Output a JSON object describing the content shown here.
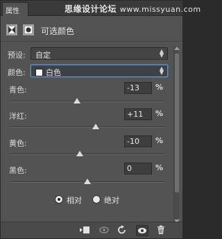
{
  "tab": {
    "label": "属性"
  },
  "watermark": {
    "brand": "思缘设计论坛",
    "url": "www.missyuan.com"
  },
  "header": {
    "title": "可选颜色",
    "icons": [
      "adjustment-layer-icon",
      "mask-icon"
    ]
  },
  "preset": {
    "label": "预设:",
    "value": "自定"
  },
  "colors": {
    "label": "颜色:",
    "value": "白色",
    "swatch": "#ffffff"
  },
  "sliders": [
    {
      "label": "青色:",
      "value": "-13",
      "unit": "%",
      "level": -13
    },
    {
      "label": "洋红:",
      "value": "+11",
      "unit": "%",
      "level": 11
    },
    {
      "label": "黄色:",
      "value": "-10",
      "unit": "%",
      "level": -10
    },
    {
      "label": "黑色:",
      "value": "0",
      "unit": "%",
      "level": 0
    }
  ],
  "method": {
    "options": [
      {
        "label": "相对",
        "selected": true
      },
      {
        "label": "绝对",
        "selected": false
      }
    ]
  },
  "footer": {
    "buttons": [
      "clip-to-layer-icon",
      "view-previous-icon",
      "reset-icon",
      "visibility-icon",
      "delete-icon"
    ]
  },
  "colors_theme": {
    "panel": "#535353",
    "field": "#454545",
    "accent": "#6c8fb7"
  }
}
